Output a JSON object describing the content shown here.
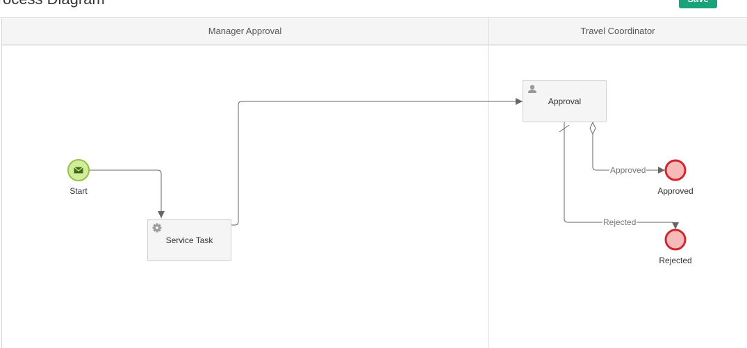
{
  "header": {
    "title": "Process Diagram",
    "save_label": "Save"
  },
  "pool": {
    "lanes": [
      {
        "name": "Manager Approval"
      },
      {
        "name": "Travel Coordinator"
      }
    ]
  },
  "nodes": {
    "start": {
      "label": "Start",
      "kind": "message-start-event",
      "icon": "envelope-icon",
      "color": "#8cc63f"
    },
    "service_task": {
      "label": "Service Task",
      "kind": "service-task",
      "icon": "gear-icon"
    },
    "approval_task": {
      "label": "Approval",
      "kind": "user-task",
      "icon": "user-icon"
    },
    "end_approved": {
      "label": "Approved",
      "kind": "end-event",
      "color": "#d0262e"
    },
    "end_rejected": {
      "label": "Rejected",
      "kind": "end-event",
      "color": "#d0262e"
    }
  },
  "flows": {
    "approved": {
      "label": "Approved"
    },
    "rejected": {
      "label": "Rejected"
    }
  }
}
